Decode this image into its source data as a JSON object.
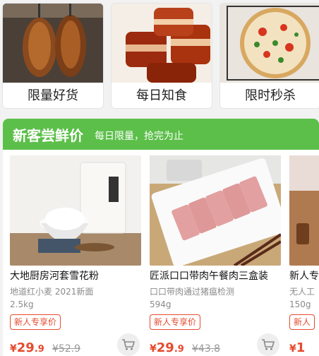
{
  "categories": [
    {
      "label": "限量好货",
      "icon": "roast-duck-image"
    },
    {
      "label": "每日知食",
      "icon": "braised-pork-image"
    },
    {
      "label": "限时秒杀",
      "icon": "pizza-image"
    }
  ],
  "banner": {
    "title": "新客尝鲜价",
    "subtitle": "每日限量，抢完为止",
    "color": "#5cbf4a"
  },
  "products": [
    {
      "name": "大地厨房河套雪花粉",
      "subtitle": "地道红小麦 2021新面",
      "spec": "2.5kg",
      "tag": "新人专享价",
      "currency": "¥",
      "price_int": "29",
      "price_dec": ".9",
      "original": "¥52.9",
      "image": "flour-bag-image"
    },
    {
      "name": "匠派口口带肉午餐肉三盒装",
      "subtitle": "口口带肉通过猪瘟检测",
      "spec": "594g",
      "tag": "新人专享价",
      "currency": "¥",
      "price_int": "29",
      "price_dec": ".9",
      "original": "¥43.8",
      "image": "luncheon-meat-image"
    },
    {
      "name": "新人专",
      "subtitle": "无人工",
      "spec": "150g",
      "tag": "新人",
      "currency": "¥",
      "price_int": "1",
      "price_dec": "",
      "original": "",
      "image": "product-image"
    }
  ],
  "accent_color": "#e64a2e"
}
